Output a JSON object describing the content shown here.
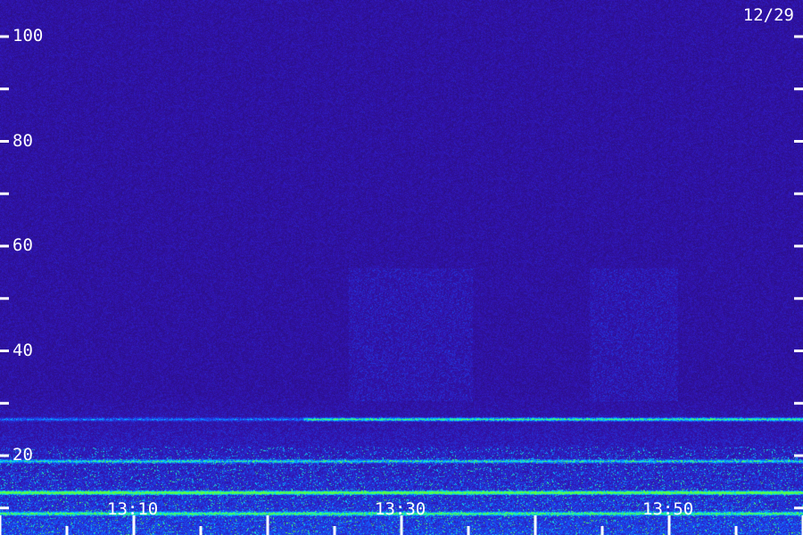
{
  "date_label": "12/29",
  "chart_data": {
    "type": "heatmap",
    "title": "",
    "xlabel": "",
    "ylabel": "",
    "y_ticks": [
      "100",
      "80",
      "60",
      "40",
      "20"
    ],
    "y_tick_values": [
      100,
      80,
      60,
      40,
      20
    ],
    "x_ticks": [
      "13:10",
      "13:30",
      "13:50"
    ],
    "x_tick_values": [
      "13:10",
      "13:30",
      "13:50"
    ],
    "xlim": [
      "13:00",
      "14:00"
    ],
    "ylim": [
      0,
      115
    ],
    "bands": [
      {
        "y": 27,
        "intensity": 0.85
      },
      {
        "y": 19,
        "intensity": 0.6
      },
      {
        "y": 13,
        "intensity": 1.0
      },
      {
        "y": 9,
        "intensity": 0.7
      },
      {
        "y": 4,
        "intensity": 0.75
      }
    ],
    "colors": {
      "background": "#2a0d6e",
      "low": "#3412a0",
      "mid": "#1a5cff",
      "high": "#00e0ff",
      "peak": "#60ff40"
    }
  }
}
